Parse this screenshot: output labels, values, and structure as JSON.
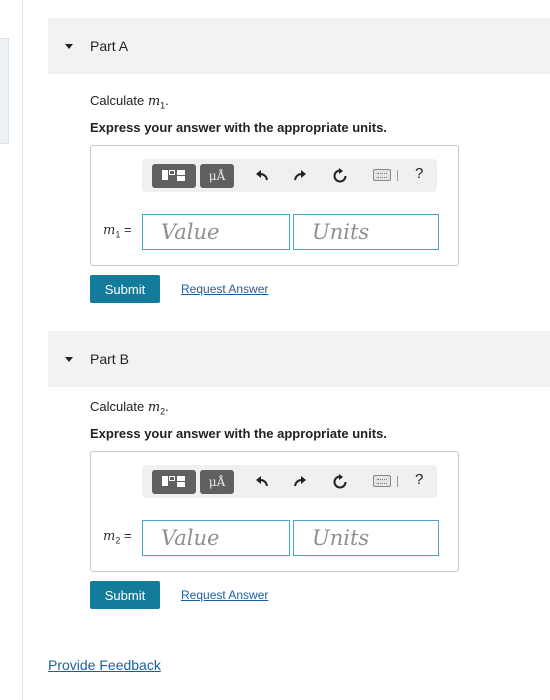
{
  "parts": [
    {
      "title": "Part A",
      "calc_prefix": "Calculate ",
      "var_symbol": "m",
      "var_sub": "1",
      "calc_suffix": ".",
      "instruction": "Express your answer with the appropriate units.",
      "label_suffix": " =",
      "value_placeholder": "Value",
      "units_placeholder": "Units",
      "toolbar": {
        "units_button": "μÅ",
        "help": "?"
      },
      "submit_label": "Submit",
      "request_label": "Request Answer"
    },
    {
      "title": "Part B",
      "calc_prefix": "Calculate ",
      "var_symbol": "m",
      "var_sub": "2",
      "calc_suffix": ".",
      "instruction": "Express your answer with the appropriate units.",
      "label_suffix": " =",
      "value_placeholder": "Value",
      "units_placeholder": "Units",
      "toolbar": {
        "units_button": "μÅ",
        "help": "?"
      },
      "submit_label": "Submit",
      "request_label": "Request Answer"
    }
  ],
  "feedback_label": "Provide Feedback",
  "colors": {
    "accent": "#137c9b",
    "link": "#1a5fa6",
    "input_border": "#4aa5c4",
    "header_bg": "#f2f2f2"
  },
  "icons": [
    "templates-icon",
    "units-icon",
    "undo-icon",
    "redo-icon",
    "reset-icon",
    "keyboard-icon",
    "help-icon"
  ]
}
